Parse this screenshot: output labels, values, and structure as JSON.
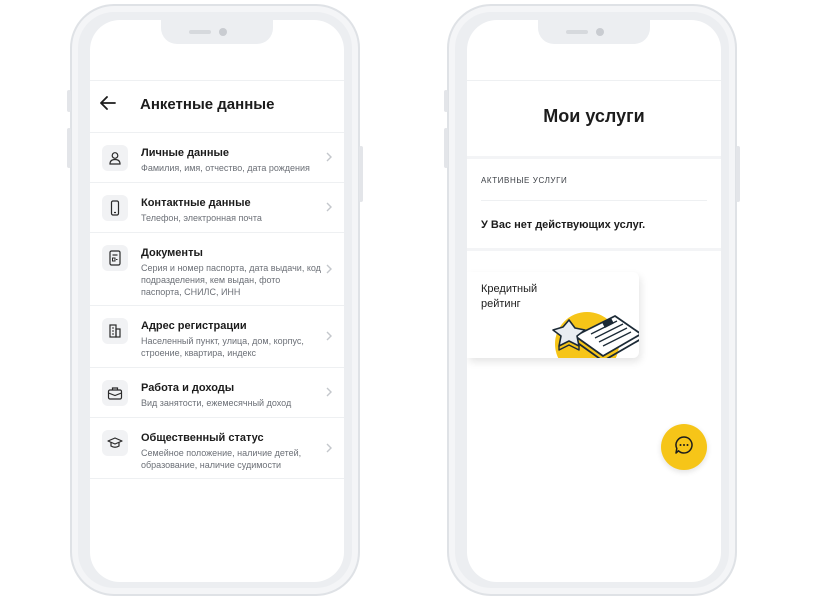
{
  "left_screen": {
    "header": {
      "back_icon": "arrow-left-icon",
      "title": "Анкетные данные"
    },
    "items": [
      {
        "icon": "person-icon",
        "title": "Личные данные",
        "subtitle": "Фамилия, имя, отчество, дата рождения"
      },
      {
        "icon": "phone-icon",
        "title": "Контактные данные",
        "subtitle": "Телефон, электронная почта"
      },
      {
        "icon": "document-icon",
        "title": "Документы",
        "subtitle": "Серия и номер паспорта, дата выдачи, код подразделения, кем выдан, фото паспорта, СНИЛС, ИНН"
      },
      {
        "icon": "building-icon",
        "title": "Адрес регистрации",
        "subtitle": "Населенный пункт, улица, дом, корпус, строение, квартира, индекс"
      },
      {
        "icon": "briefcase-icon",
        "title": "Работа и доходы",
        "subtitle": "Вид занятости, ежемесячный доход"
      },
      {
        "icon": "graduation-cap-icon",
        "title": "Общественный статус",
        "subtitle": "Семейное положение, наличие детей, образование, наличие судимости"
      }
    ]
  },
  "right_screen": {
    "title": "Мои услуги",
    "section_label": "АКТИВНЫЕ УСЛУГИ",
    "empty_message": "У Вас нет действующих услуг.",
    "card": {
      "title": "Кредитный рейтинг"
    },
    "chat_icon": "chat-bubble-icon"
  },
  "colors": {
    "accent": "#f6c518",
    "phone_frame": "#eceef1",
    "icon_bg": "#f1f2f4",
    "muted_text": "#6c7077"
  }
}
